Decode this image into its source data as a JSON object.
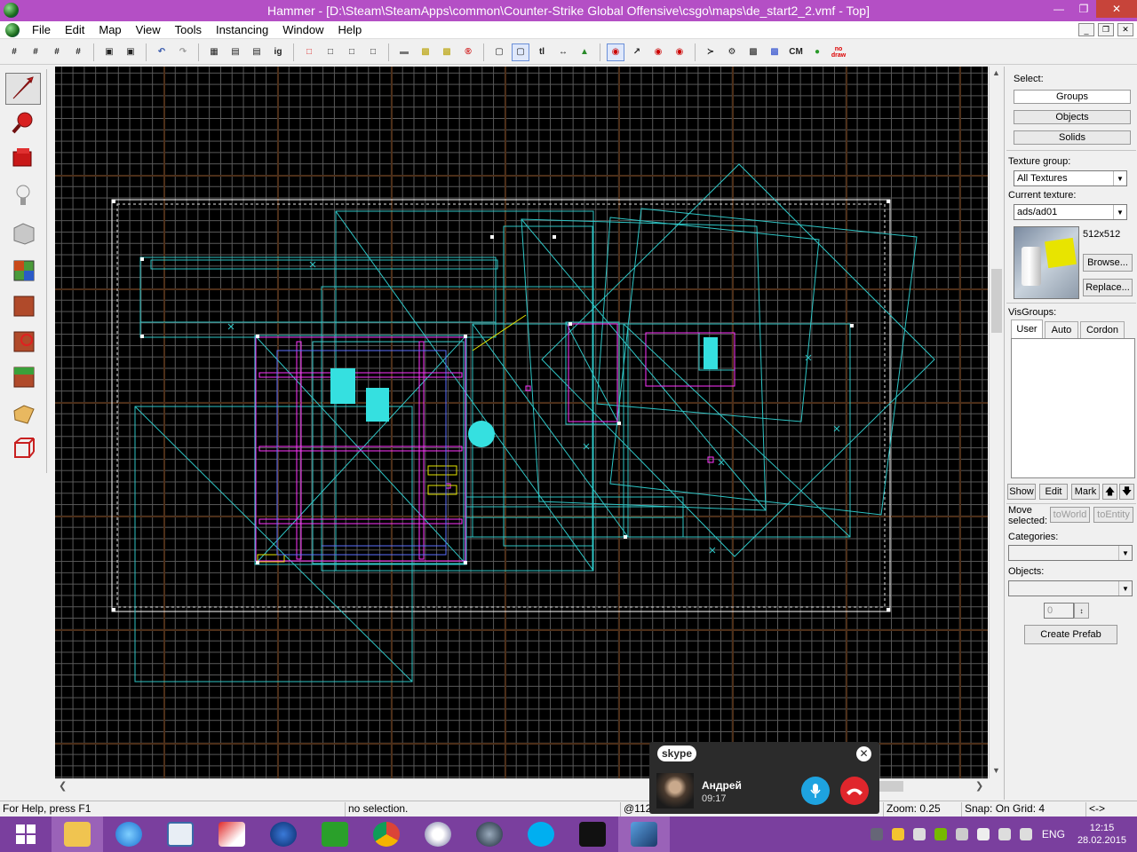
{
  "window": {
    "title": "Hammer - [D:\\Steam\\SteamApps\\common\\Counter-Strike Global Offensive\\csgo\\maps\\de_start2_2.vmf - Top]"
  },
  "menu": [
    "File",
    "Edit",
    "Map",
    "View",
    "Tools",
    "Instancing",
    "Window",
    "Help"
  ],
  "toolbar_text": {
    "tl": "tl",
    "cm": "CM",
    "ig": "ig",
    "nodraw": "no draw"
  },
  "right_panel": {
    "select_label": "Select:",
    "groups": "Groups",
    "objects": "Objects",
    "solids": "Solids",
    "texture_group_label": "Texture group:",
    "texture_group_value": "All Textures",
    "current_texture_label": "Current texture:",
    "current_texture_value": "ads/ad01",
    "texture_size": "512x512",
    "browse": "Browse...",
    "replace": "Replace...",
    "visgroups_label": "VisGroups:",
    "tabs": [
      "User",
      "Auto",
      "Cordon"
    ],
    "show": "Show",
    "edit": "Edit",
    "mark": "Mark",
    "move_selected_label": "Move selected:",
    "to_world": "toWorld",
    "to_entity": "toEntity",
    "categories_label": "Categories:",
    "objects_label": "Objects:",
    "count_value": "0",
    "create_prefab": "Create Prefab"
  },
  "status": {
    "help": "For Help, press F1",
    "selection": "no selection.",
    "coords": "@112",
    "zoom": "Zoom: 0.25",
    "snap": "Snap: On Grid: 4",
    "arrows": "<->"
  },
  "skype": {
    "logo": "skype",
    "caller": "Андрей",
    "duration": "09:17"
  },
  "tray": {
    "lang": "ENG",
    "time": "12:15",
    "date": "28.02.2015"
  },
  "colors": {
    "titlebar": "#b44fc5",
    "taskbar": "#7a3f9e",
    "viewport_bg": "#000000",
    "brush": "#2ec5c5",
    "entity": "#ff33ff",
    "grid": "#5a5a5a"
  }
}
